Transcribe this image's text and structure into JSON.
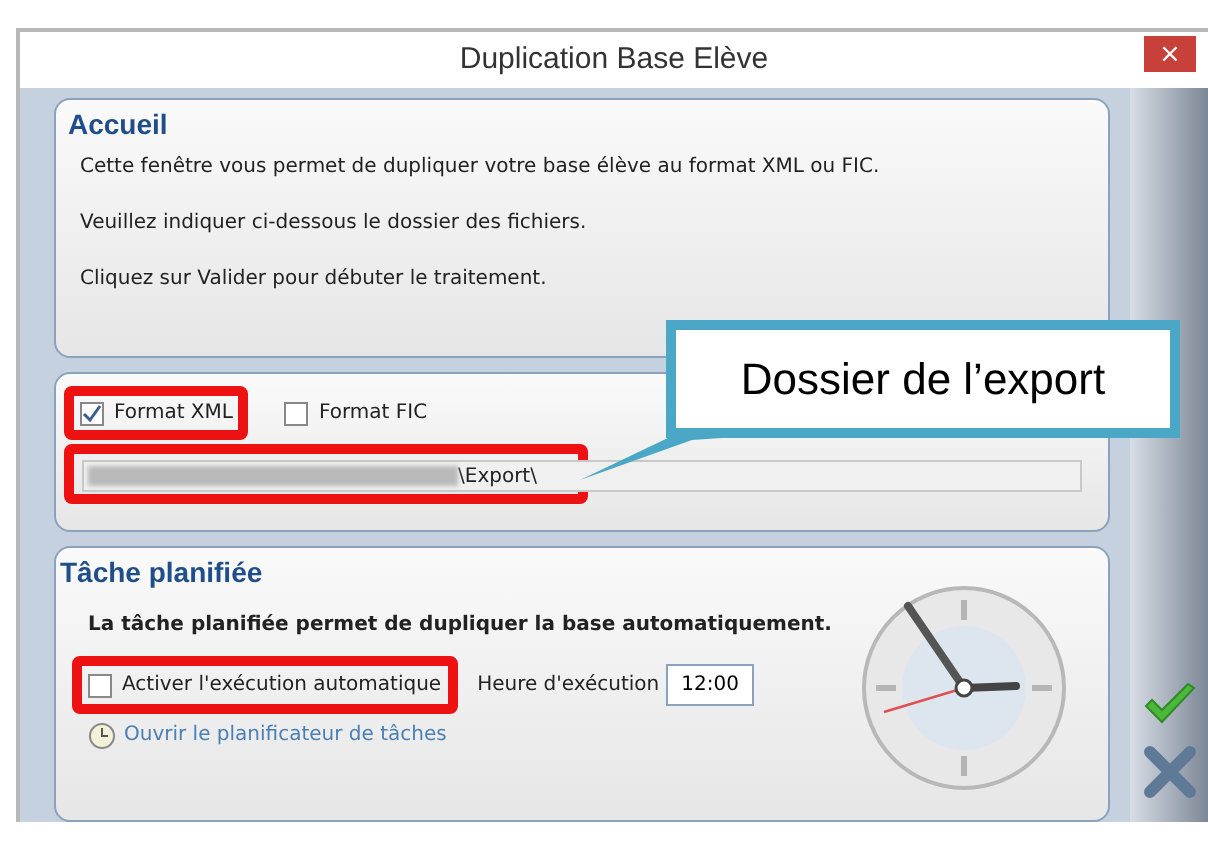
{
  "window": {
    "title": "Duplication Base Elève",
    "close": "×"
  },
  "welcome": {
    "title": "Accueil",
    "lines": [
      "Cette fenêtre vous permet de dupliquer votre base élève au format XML ou FIC.",
      "Veuillez indiquer ci-dessous le dossier des fichiers.",
      "Cliquez sur Valider pour débuter le traitement."
    ]
  },
  "formats": [
    {
      "label": "Format XML",
      "checked": true,
      "highlighted": true
    },
    {
      "label": "Format FIC",
      "checked": false,
      "highlighted": false
    }
  ],
  "folder": {
    "value": "\\Export\\",
    "highlighted": true
  },
  "schedule": {
    "title": "Tâche planifiée",
    "description": "La tâche planifiée permet de dupliquer la base automatiquement.",
    "auto": {
      "label": "Activer l'exécution automatique",
      "checked": false,
      "highlighted": true
    },
    "time_label": "Heure d'exécution",
    "time": "12:00",
    "link": "Ouvrir le planificateur de tâches"
  },
  "callout": {
    "text": "Dossier de l’export"
  }
}
